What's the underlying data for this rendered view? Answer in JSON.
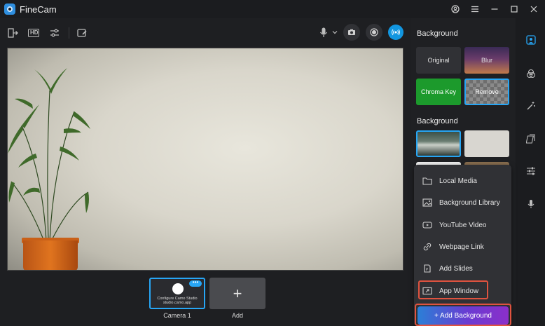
{
  "app": {
    "name": "FineCam"
  },
  "titlebar": {
    "icons": [
      "account-icon",
      "menu-icon",
      "minimize-icon",
      "maximize-icon",
      "close-icon"
    ]
  },
  "toolbar": {
    "hd_label": "HD",
    "left_icons": [
      "exit-icon",
      "hd-icon",
      "adjust-icon",
      "draw-icon"
    ],
    "right_icons": [
      "microphone-icon",
      "chevron-down-icon",
      "camera-icon",
      "record-icon",
      "live-icon"
    ],
    "live_color": "#1296e0"
  },
  "sources": {
    "items": [
      {
        "label": "Camera 1",
        "thumb_text": "Configure Camo Studio",
        "thumb_subtext": "studio.camo.app",
        "more_label": "•••"
      }
    ],
    "add_label": "Add",
    "add_symbol": "+"
  },
  "panel": {
    "background_title": "Background",
    "tiles": [
      {
        "label": "Original"
      },
      {
        "label": "Blur"
      },
      {
        "label": "Chroma Key"
      },
      {
        "label": "Remove"
      }
    ],
    "gallery_title": "Background",
    "accent": "#27a6f5"
  },
  "menu": {
    "items": [
      {
        "label": "Local Media",
        "icon": "folder-icon"
      },
      {
        "label": "Background Library",
        "icon": "image-icon"
      },
      {
        "label": "YouTube Video",
        "icon": "youtube-icon"
      },
      {
        "label": "Webpage Link",
        "icon": "link-icon"
      },
      {
        "label": "Add Slides",
        "icon": "slides-icon"
      },
      {
        "label": "App Window",
        "icon": "window-icon"
      }
    ],
    "add_background": "+ Add Background",
    "highlight_color": "#e0533f"
  },
  "rail": {
    "icons": [
      "person-icon",
      "blend-icon",
      "magic-wand-icon",
      "layers-icon",
      "sliders-icon",
      "microphone-icon"
    ]
  }
}
